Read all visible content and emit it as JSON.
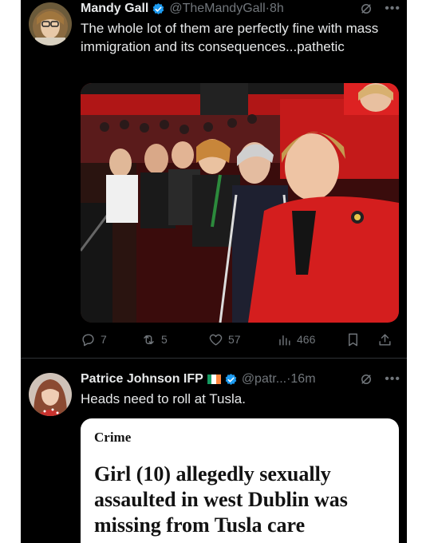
{
  "tweets": [
    {
      "author": {
        "name": "Mandy Gall",
        "handle": "@TheMandyGall",
        "separator": "·",
        "time": "8h",
        "verified": true
      },
      "text": "The whole lot of them are perfectly fine with mass immigration and its consequences...pathetic",
      "stats": {
        "replies": "7",
        "reposts": "5",
        "likes": "57",
        "views": "466"
      }
    },
    {
      "author": {
        "name": "Patrice Johnson IFP",
        "handle": "@patr...",
        "separator": "·",
        "time": "16m",
        "verified": true,
        "flag_colors": [
          "#169b62",
          "#ffffff",
          "#ff883e"
        ]
      },
      "text": "Heads need to roll at Tusla.",
      "link_card": {
        "category": "Crime",
        "headline": "Girl (10) allegedly sexually assaulted in west Dublin was missing from Tusla care"
      }
    }
  ],
  "icons": {
    "verified": "verified-badge-icon",
    "grok": "grok-icon",
    "more": "more-icon",
    "reply": "reply-icon",
    "repost": "repost-icon",
    "like": "heart-icon",
    "views": "views-icon",
    "bookmark": "bookmark-icon",
    "share": "share-icon"
  },
  "colors": {
    "background": "#000000",
    "text": "#e7e9ea",
    "secondary": "#71767b",
    "verified": "#1d9bf0"
  }
}
